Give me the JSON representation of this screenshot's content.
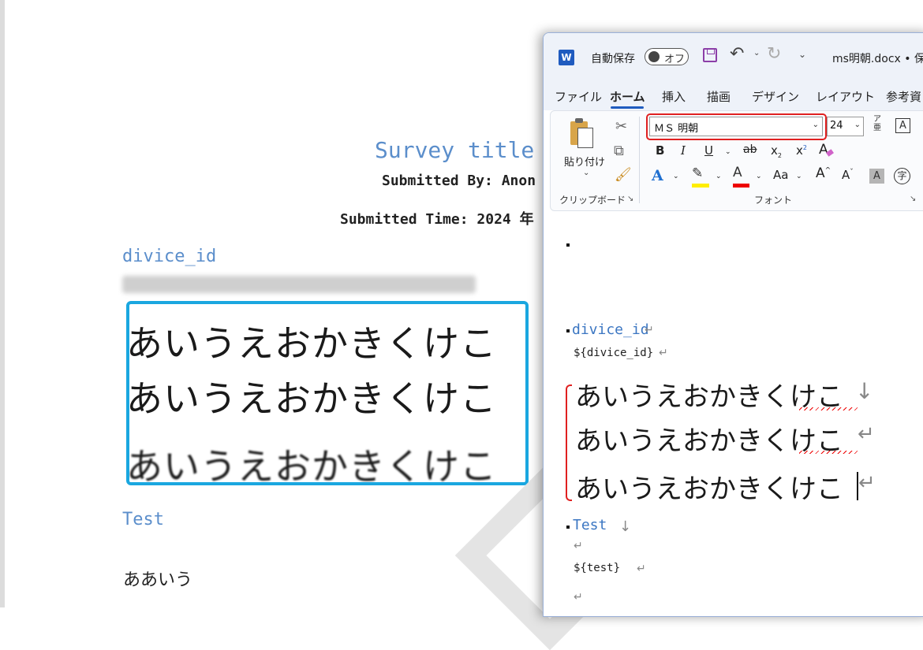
{
  "document_preview": {
    "title": "Survey title",
    "submitted_by": "Submitted By: Anon",
    "submitted_time": "Submitted Time: 2024 年",
    "field_1_label": "divice_id",
    "japanese_lines": [
      "あいうえおかきくけこ",
      "あいうえおかきくけこ",
      "あいうえおかきくけこ"
    ],
    "field_2_label": "Test",
    "field_2_value": "ああいう"
  },
  "word_window": {
    "autosave_label": "自動保存",
    "autosave_state": "オフ",
    "doc_title": "ms明朝.docx • 保",
    "tabs": [
      "ファイル",
      "ホーム",
      "挿入",
      "描画",
      "デザイン",
      "レイアウト",
      "参考資"
    ],
    "active_tab": "ホーム",
    "clipboard": {
      "paste_label": "貼り付け",
      "group_label": "クリップボード"
    },
    "font": {
      "name": "ＭＳ 明朝",
      "size": "24",
      "group_label": "フォント",
      "bold": "B",
      "italic": "I",
      "underline": "U",
      "strike": "ab",
      "subscript": "x",
      "superscript": "x",
      "text_effect": "A",
      "font_color": "A",
      "change_case": "Aa",
      "grow": "A",
      "shrink": "A",
      "char_border": "A",
      "char_shading": "A",
      "enclose": "字",
      "phonetic_top": "ア",
      "phonetic_bottom": "亜"
    },
    "body": {
      "field_1_label": "divice_id",
      "field_1_placeholder": "${divice_id}",
      "japanese_lines": [
        "あいうえおかきくけこ",
        "あいうえおかきくけこ",
        "あいうえおかきくけこ"
      ],
      "field_2_label": "Test",
      "field_2_placeholder": "${test}"
    }
  },
  "colors": {
    "accent_blue": "#1aa7e0",
    "annotation_red": "#e02020",
    "word_blue": "#1f5bbf",
    "heading_blue": "#5b8ecb"
  }
}
